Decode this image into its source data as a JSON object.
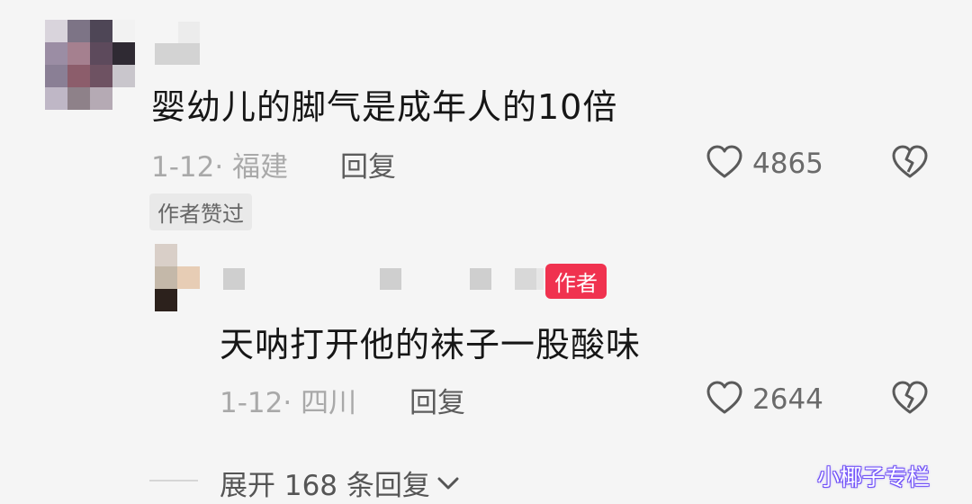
{
  "comments": [
    {
      "text": "婴幼儿的脚气是成年人的10倍",
      "meta": "1-12· 福建",
      "reply_label": "回复",
      "likes": "4865",
      "tag": "作者赞过"
    }
  ],
  "replies": [
    {
      "badge": "作者",
      "text": "天呐打开他的袜子一股酸味",
      "meta": "1-12· 四川",
      "reply_label": "回复",
      "likes": "2644"
    }
  ],
  "expand_label": "展开 168 条回复",
  "watermark": "小椰子专栏",
  "icons": {
    "like": "heart-outline-icon",
    "dislike": "broken-heart-icon",
    "expand": "chevron-down-icon"
  },
  "colors": {
    "background": "#f5f5f5",
    "author_badge": "#f0324f",
    "muted_text": "#a9a9a9"
  }
}
